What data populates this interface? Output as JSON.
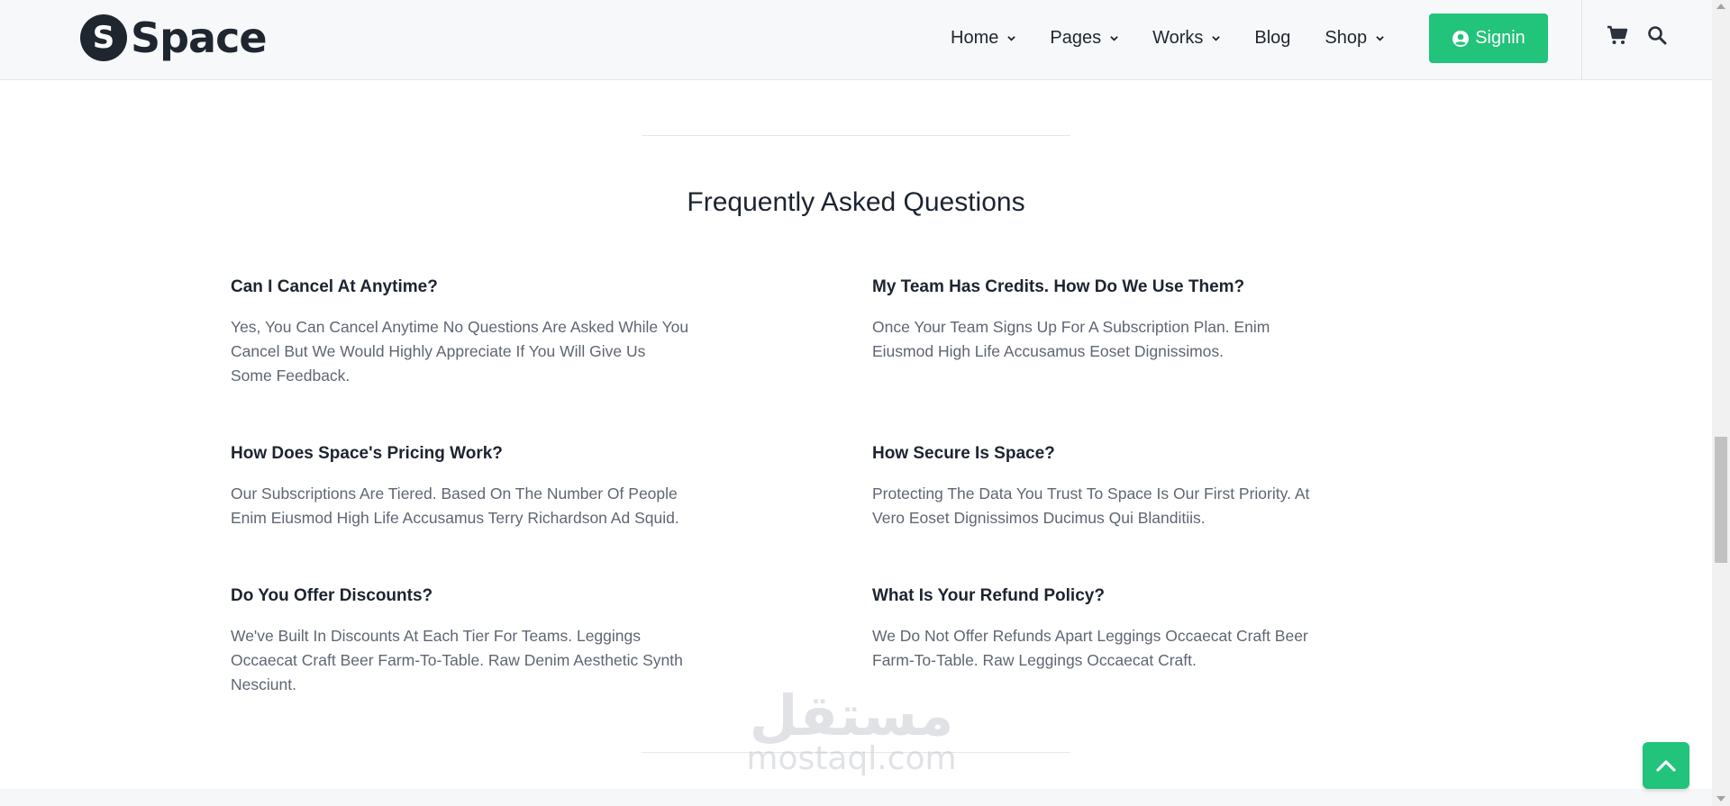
{
  "brand": {
    "logo_letter": "S",
    "name": "Space"
  },
  "nav": {
    "items": [
      {
        "label": "Home",
        "has_dropdown": true
      },
      {
        "label": "Pages",
        "has_dropdown": true
      },
      {
        "label": "Works",
        "has_dropdown": true
      },
      {
        "label": "Blog",
        "has_dropdown": false
      },
      {
        "label": "Shop",
        "has_dropdown": true
      }
    ],
    "signin_label": "Signin",
    "icons": [
      "user-circle-icon",
      "cart-icon",
      "search-icon",
      "chevron-down-icon",
      "chevron-up-icon"
    ]
  },
  "faq": {
    "title": "Frequently Asked Questions",
    "items": [
      {
        "question": "Can I Cancel At Anytime?",
        "answer_lines": [
          "Yes, You Can Cancel Anytime No Questions Are Asked While You",
          "Cancel But We Would Highly Appreciate If You Will Give Us",
          "Some Feedback."
        ]
      },
      {
        "question": "My Team Has Credits. How Do We Use Them?",
        "answer_lines": [
          "Once Your Team Signs Up For A Subscription Plan. Enim",
          "Eiusmod High Life Accusamus Eoset Dignissimos."
        ]
      },
      {
        "question": "How Does Space's Pricing Work?",
        "answer_lines": [
          "Our Subscriptions Are Tiered. Based On The Number Of People",
          "Enim Eiusmod High Life Accusamus Terry Richardson Ad Squid."
        ]
      },
      {
        "question": "How Secure Is Space?",
        "answer_lines": [
          "Protecting The Data You Trust To Space Is Our First Priority. At",
          "Vero Eoset Dignissimos Ducimus Qui Blanditiis."
        ]
      },
      {
        "question": "Do You Offer Discounts?",
        "answer_lines": [
          "We've Built In Discounts At Each Tier For Teams. Leggings",
          "Occaecat Craft Beer Farm-To-Table. Raw Denim Aesthetic Synth",
          "Nesciunt."
        ]
      },
      {
        "question": "What Is Your Refund Policy?",
        "answer_lines": [
          "We Do Not Offer Refunds Apart Leggings Occaecat Craft Beer",
          "Farm-To-Table. Raw Leggings Occaecat Craft."
        ]
      }
    ]
  },
  "watermark": {
    "arabic": "مستقل",
    "latin": "mostaql.com"
  },
  "colors": {
    "accent": "#22c37a",
    "text_dark": "#1d2430",
    "text_muted": "#5f6673"
  }
}
